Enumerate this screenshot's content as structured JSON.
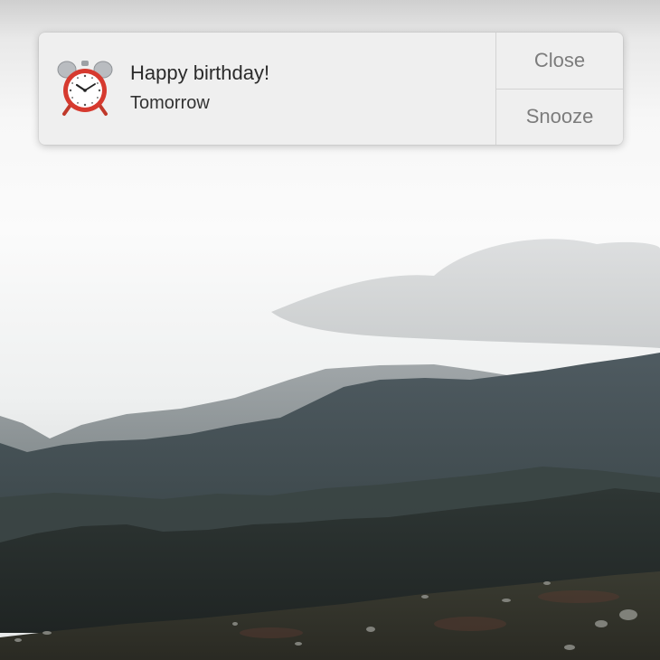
{
  "notification": {
    "app_icon": "alarm-clock-icon",
    "title": "Happy birthday!",
    "subtitle": "Tomorrow",
    "actions": {
      "close_label": "Close",
      "snooze_label": "Snooze"
    }
  },
  "desktop": {
    "wallpaper": "mountain-landscape"
  },
  "colors": {
    "notification_background": "#efefef",
    "action_text": "#7c7c7c",
    "title_text": "#2b2b2b"
  }
}
